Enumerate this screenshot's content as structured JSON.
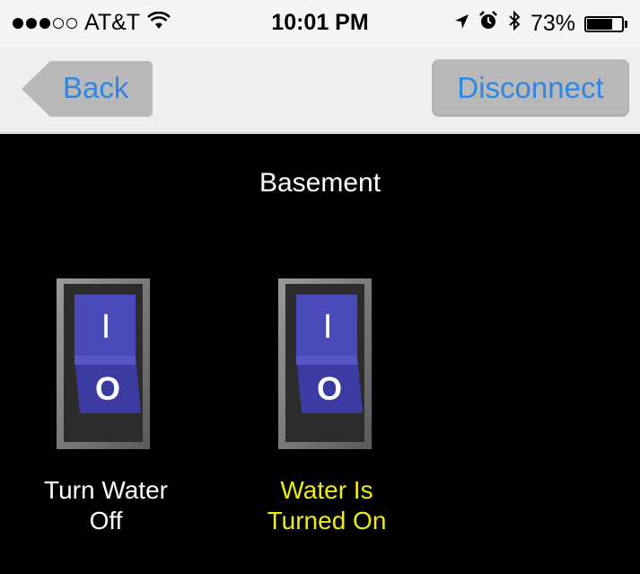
{
  "status_bar": {
    "carrier": "AT&T",
    "time": "10:01 PM",
    "battery_percent": "73%",
    "battery_level": 0.73,
    "signal_bars_filled": 3,
    "signal_bars_total": 5
  },
  "nav": {
    "back_label": "Back",
    "disconnect_label": "Disconnect"
  },
  "room": {
    "title": "Basement"
  },
  "switches": [
    {
      "label_line1": "Turn Water",
      "label_line2": "Off",
      "on_glyph": "I",
      "off_glyph": "O",
      "label_color": "#ffffff"
    },
    {
      "label_line1": "Water Is",
      "label_line2": "Turned On",
      "on_glyph": "I",
      "off_glyph": "O",
      "label_color": "#ecec18"
    }
  ],
  "colors": {
    "link_blue": "#2f86e4",
    "switch_blue": "#4a4ab8",
    "status_yellow": "#ecec18",
    "background": "#000000"
  },
  "icons": [
    "signal-dots-icon",
    "wifi-icon",
    "location-arrow-icon",
    "alarm-clock-icon",
    "bluetooth-icon",
    "battery-icon",
    "back-chevron-icon"
  ]
}
